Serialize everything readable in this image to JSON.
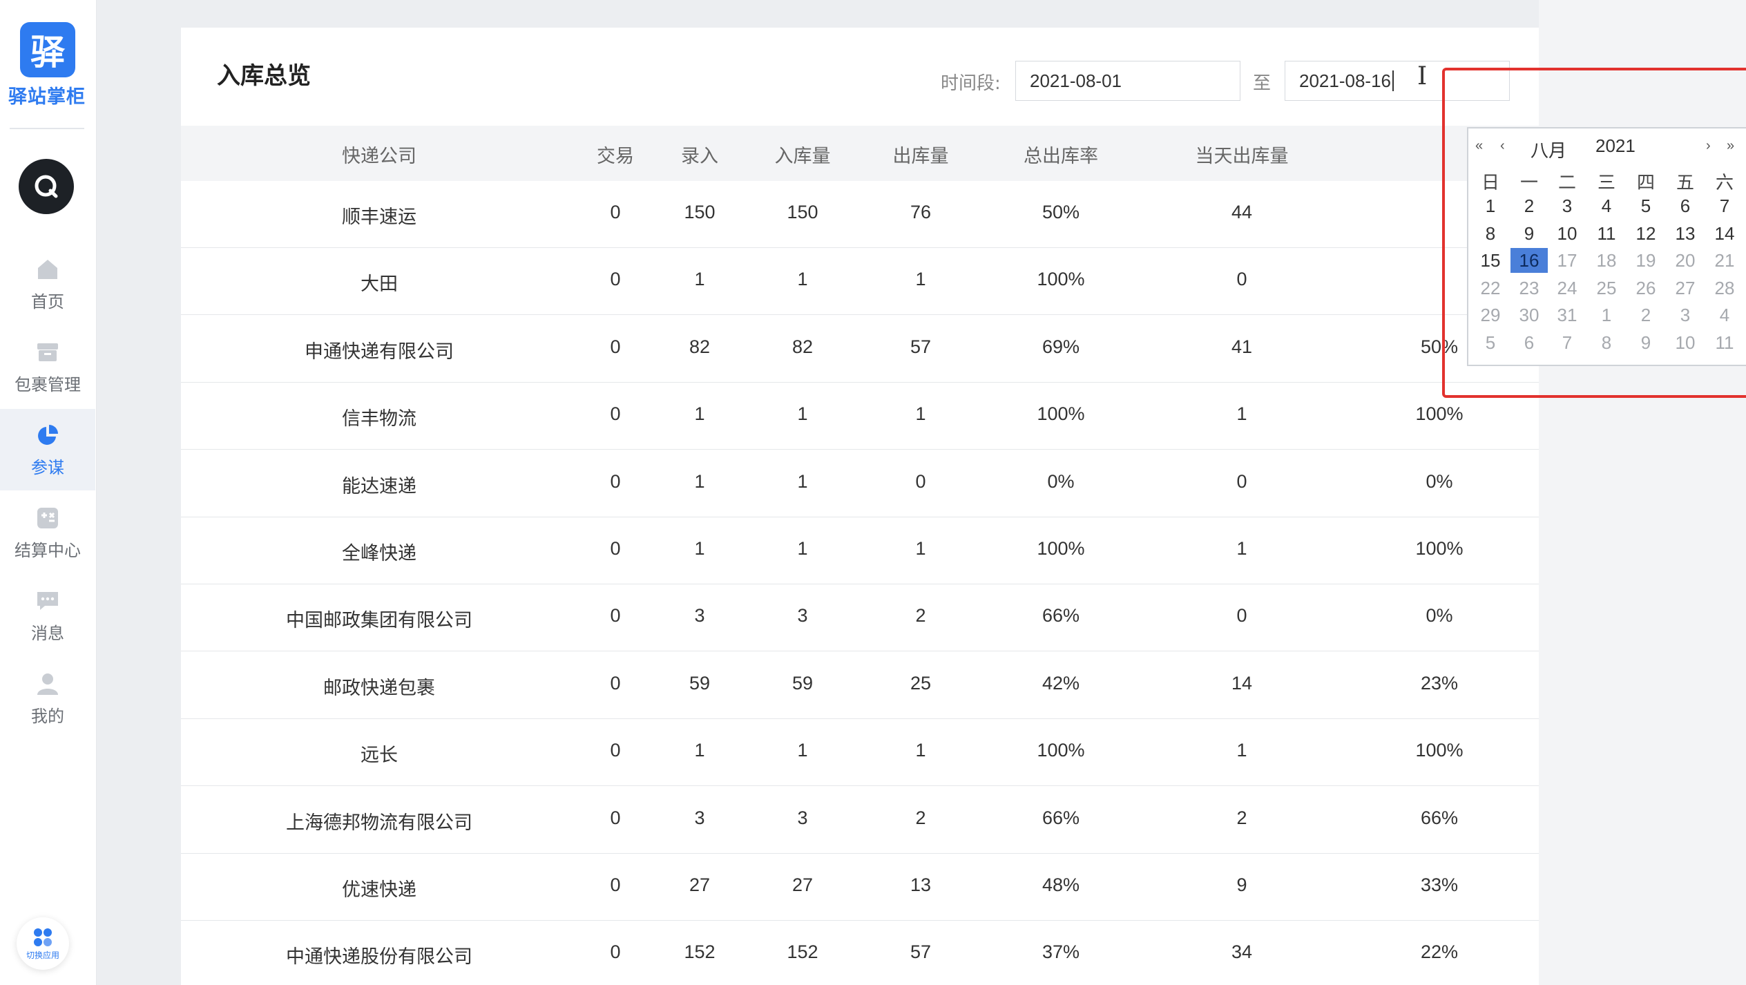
{
  "sidebar": {
    "logo_char": "驿",
    "logo_text": "驿站掌柜",
    "nav": [
      {
        "label": "首页",
        "icon": "home-icon",
        "active": false
      },
      {
        "label": "包裹管理",
        "icon": "package-icon",
        "active": false
      },
      {
        "label": "参谋",
        "icon": "pie-chart-icon",
        "active": true
      },
      {
        "label": "结算中心",
        "icon": "settlement-icon",
        "active": false
      },
      {
        "label": "消息",
        "icon": "message-icon",
        "active": false
      },
      {
        "label": "我的",
        "icon": "user-icon",
        "active": false
      }
    ],
    "switch_app_label": "切换应用"
  },
  "header": {
    "title": "入库总览",
    "range_label": "时间段:",
    "date_from": "2021-08-01",
    "to_label": "至",
    "date_to": "2021-08-16"
  },
  "table": {
    "columns": [
      "快递公司",
      "交易",
      "录入",
      "入库量",
      "出库量",
      "总出库率",
      "当天出库量",
      ""
    ],
    "rows": [
      [
        "顺丰速运",
        "0",
        "150",
        "150",
        "76",
        "50%",
        "44",
        ""
      ],
      [
        "大田",
        "0",
        "1",
        "1",
        "1",
        "100%",
        "0",
        ""
      ],
      [
        "申通快递有限公司",
        "0",
        "82",
        "82",
        "57",
        "69%",
        "41",
        "50%"
      ],
      [
        "信丰物流",
        "0",
        "1",
        "1",
        "1",
        "100%",
        "1",
        "100%"
      ],
      [
        "能达速递",
        "0",
        "1",
        "1",
        "0",
        "0%",
        "0",
        "0%"
      ],
      [
        "全峰快递",
        "0",
        "1",
        "1",
        "1",
        "100%",
        "1",
        "100%"
      ],
      [
        "中国邮政集团有限公司",
        "0",
        "3",
        "3",
        "2",
        "66%",
        "0",
        "0%"
      ],
      [
        "邮政快递包裹",
        "0",
        "59",
        "59",
        "25",
        "42%",
        "14",
        "23%"
      ],
      [
        "远长",
        "0",
        "1",
        "1",
        "1",
        "100%",
        "1",
        "100%"
      ],
      [
        "上海德邦物流有限公司",
        "0",
        "3",
        "3",
        "2",
        "66%",
        "2",
        "66%"
      ],
      [
        "优速快递",
        "0",
        "27",
        "27",
        "13",
        "48%",
        "9",
        "33%"
      ],
      [
        "中通快递股份有限公司",
        "0",
        "152",
        "152",
        "57",
        "37%",
        "34",
        "22%"
      ]
    ]
  },
  "calendar": {
    "month": "八月",
    "year": "2021",
    "weekdays": [
      "日",
      "一",
      "二",
      "三",
      "四",
      "五",
      "六"
    ],
    "weeks": [
      [
        "1",
        "2",
        "3",
        "4",
        "5",
        "6",
        "7"
      ],
      [
        "8",
        "9",
        "10",
        "11",
        "12",
        "13",
        "14"
      ],
      [
        "15",
        "16",
        "17",
        "18",
        "19",
        "20",
        "21"
      ],
      [
        "22",
        "23",
        "24",
        "25",
        "26",
        "27",
        "28"
      ],
      [
        "29",
        "30",
        "31",
        "1",
        "2",
        "3",
        "4"
      ],
      [
        "5",
        "6",
        "7",
        "8",
        "9",
        "10",
        "11"
      ]
    ],
    "selected_day": "16",
    "nav": {
      "prev_year": "«",
      "prev_month": "‹",
      "next_month": "›",
      "next_year": "»"
    }
  }
}
